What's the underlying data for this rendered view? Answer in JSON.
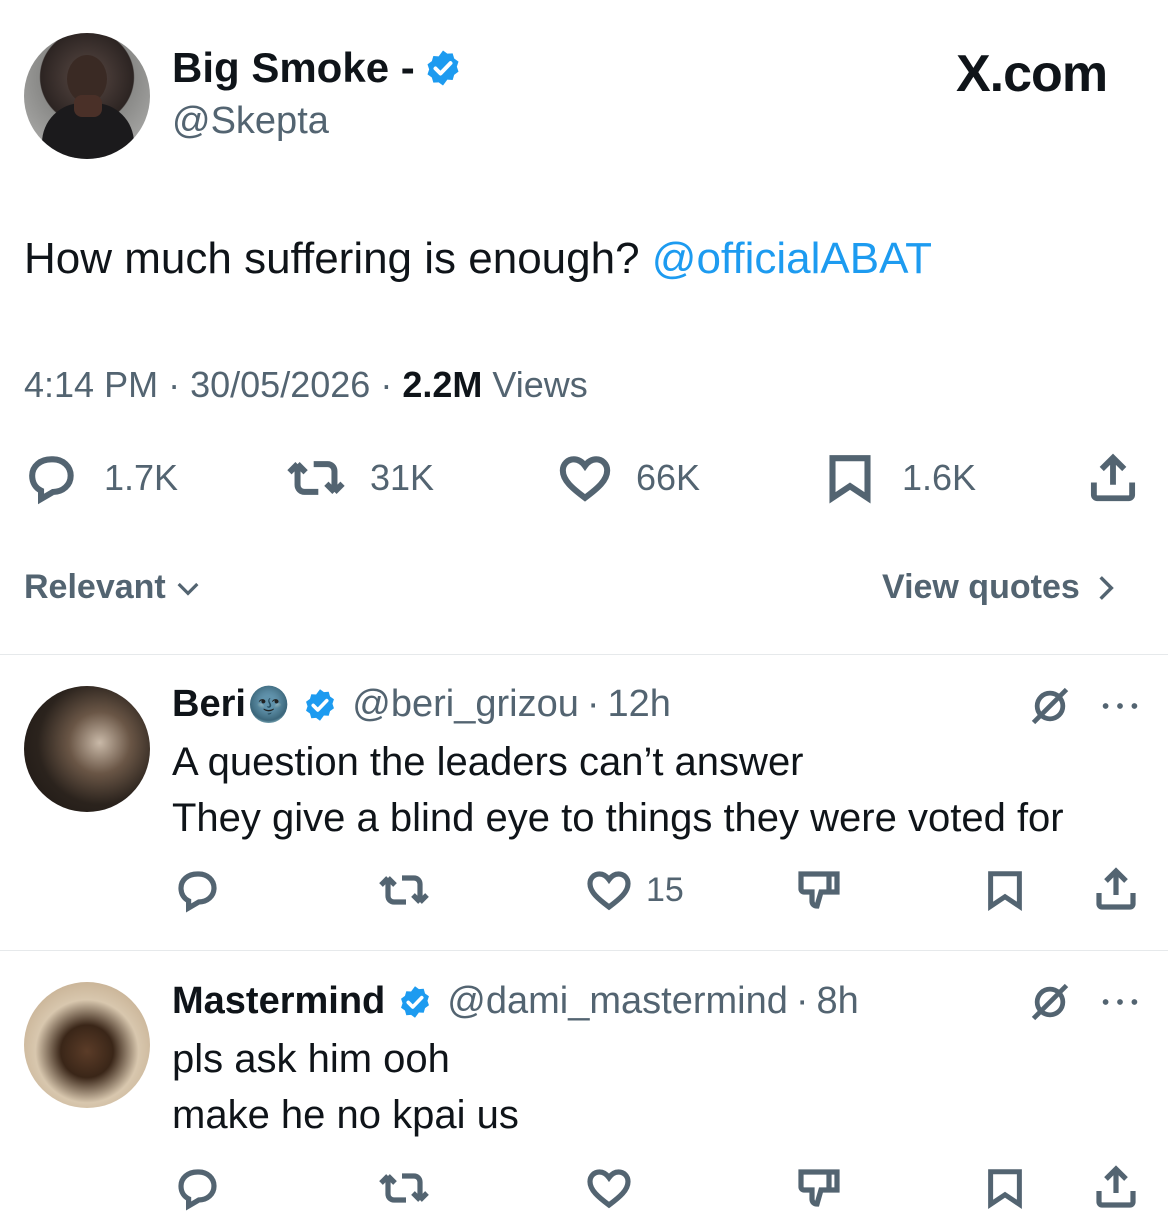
{
  "post": {
    "author_name": "Big Smoke -",
    "author_handle": "@Skepta",
    "site_label": "X.com",
    "text": "How much suffering is enough?",
    "mention": "@officialABAT",
    "time": "4:14 PM",
    "date": "30/05/2026",
    "views_count": "2.2M",
    "views_label": "Views",
    "separator": "·",
    "stats": {
      "replies": "1.7K",
      "reposts": "31K",
      "likes": "66K",
      "bookmarks": "1.6K"
    }
  },
  "controls": {
    "sort_label": "Relevant",
    "view_quotes_label": "View quotes"
  },
  "replies": [
    {
      "name": "Beri",
      "name_emoji": "🌚",
      "handle": "@beri_grizou",
      "age": "12h",
      "line1": "A question the leaders can’t answer",
      "line2": "They give a blind eye to things they were voted for",
      "likes": "15"
    },
    {
      "name": "Mastermind",
      "handle": "@dami_mastermind",
      "age": "8h",
      "line1": "pls ask him ooh",
      "line2": "make he no kpai us"
    }
  ],
  "colors": {
    "accent": "#1d9bf0",
    "secondary_text": "#536471",
    "primary_text": "#0f1419"
  },
  "icons": [
    "verified-badge-icon",
    "reply-icon",
    "repost-icon",
    "like-icon",
    "bookmark-icon",
    "share-icon",
    "grok-icon",
    "more-icon",
    "chevron-down-icon",
    "chevron-right-icon",
    "dislike-icon"
  ]
}
